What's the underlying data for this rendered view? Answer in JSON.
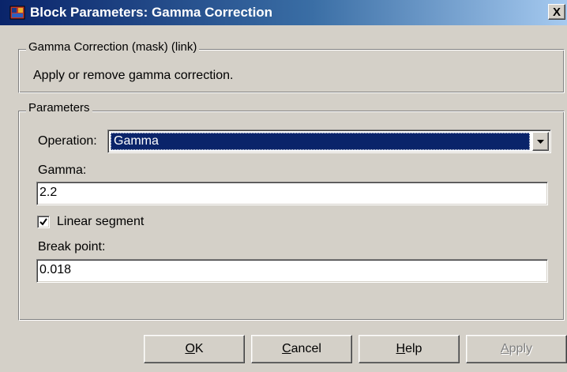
{
  "window": {
    "title": "Block Parameters: Gamma Correction",
    "close_label": "X"
  },
  "description_group": {
    "legend": "Gamma Correction (mask) (link)",
    "text": "Apply or remove gamma correction."
  },
  "parameters_group": {
    "legend": "Parameters",
    "operation": {
      "label": "Operation:",
      "selected": "Gamma"
    },
    "gamma": {
      "label": "Gamma:",
      "value": "2.2"
    },
    "linear_segment": {
      "label": "Linear segment",
      "checked": true
    },
    "break_point": {
      "label": "Break point:",
      "value": "0.018"
    }
  },
  "buttons": {
    "ok": {
      "mnemonic": "O",
      "rest": "K"
    },
    "cancel": {
      "mnemonic": "C",
      "rest": "ancel"
    },
    "help": {
      "mnemonic": "H",
      "rest": "elp"
    },
    "apply": {
      "mnemonic": "A",
      "rest": "pply",
      "enabled": false
    }
  },
  "icons": {
    "app": "simulink-block-icon",
    "dropdown": "chevron-down-icon",
    "check": "checkmark-icon"
  },
  "colors": {
    "titlebar_start": "#0a246a",
    "titlebar_end": "#a6caf0",
    "face": "#d4d0c8",
    "selection": "#0a246a"
  }
}
